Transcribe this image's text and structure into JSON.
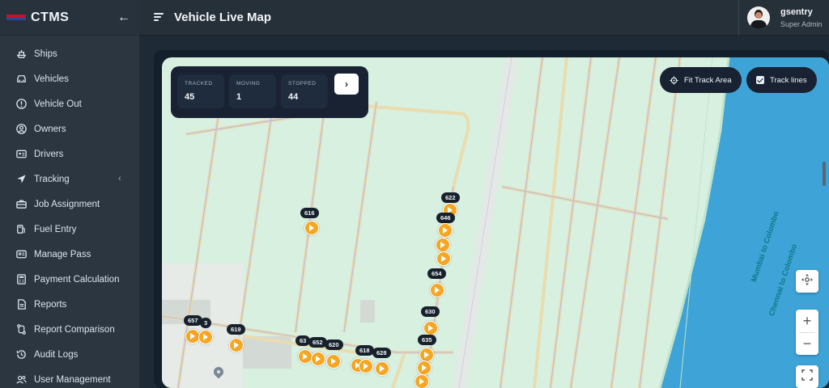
{
  "app": {
    "name": "CTMS"
  },
  "header": {
    "title": "Vehicle Live Map"
  },
  "user": {
    "name": "gsentry",
    "role": "Super Admin"
  },
  "sidebar": {
    "items": [
      {
        "label": "Ships",
        "icon": "ship-icon"
      },
      {
        "label": "Vehicles",
        "icon": "car-icon"
      },
      {
        "label": "Vehicle Out",
        "icon": "alert-circle-icon"
      },
      {
        "label": "Owners",
        "icon": "user-circle-icon"
      },
      {
        "label": "Drivers",
        "icon": "id-card-icon"
      },
      {
        "label": "Tracking",
        "icon": "navigation-icon",
        "has_submenu": true
      },
      {
        "label": "Job Assignment",
        "icon": "briefcase-icon"
      },
      {
        "label": "Fuel Entry",
        "icon": "fuel-pump-icon"
      },
      {
        "label": "Manage Pass",
        "icon": "badge-icon"
      },
      {
        "label": "Payment Calculation",
        "icon": "calculator-icon"
      },
      {
        "label": "Reports",
        "icon": "file-icon"
      },
      {
        "label": "Report Comparison",
        "icon": "compare-icon"
      },
      {
        "label": "Audit Logs",
        "icon": "history-icon"
      },
      {
        "label": "User Management",
        "icon": "users-icon"
      }
    ]
  },
  "stats": {
    "tracked_label": "TRACKED",
    "tracked_value": "45",
    "moving_label": "MOVING",
    "moving_value": "1",
    "stopped_label": "STOPPED",
    "stopped_value": "44",
    "next_label": "›"
  },
  "map_controls": {
    "fit_track_label": "Fit Track Area",
    "track_lines_label": "Track lines",
    "track_lines_checked": true,
    "zoom_in": "+",
    "zoom_out": "−"
  },
  "road_labels": [
    "Mumbai to Colombo",
    "Chennai to Colombo"
  ],
  "vehicles": [
    "622",
    "646",
    "616",
    "654",
    "630",
    "635",
    "657",
    "619",
    "652",
    "620",
    "618",
    "628",
    "63",
    "3"
  ],
  "colors": {
    "accent": "#f5a623",
    "map_land": "#d8f0e0",
    "map_water": "#3ea3d6",
    "panel": "#182232"
  }
}
